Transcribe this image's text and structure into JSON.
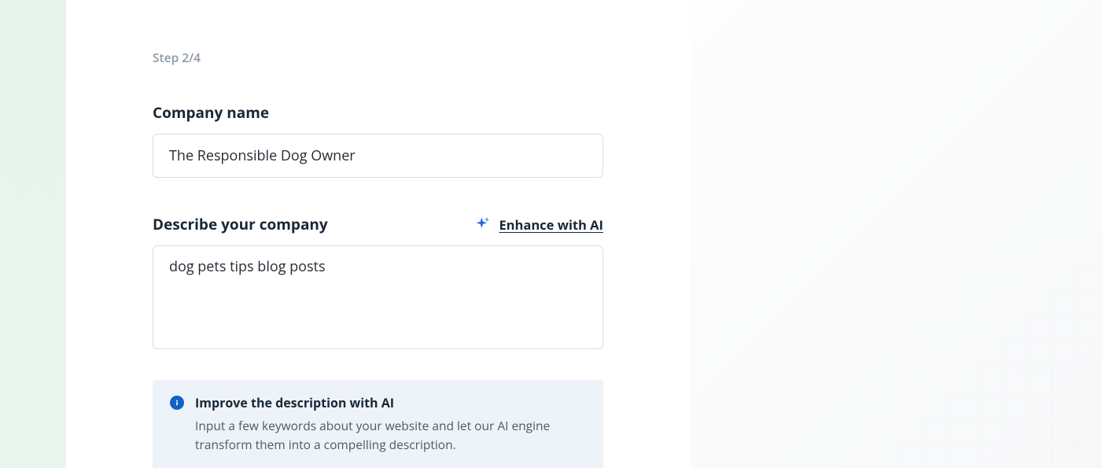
{
  "step": {
    "label": "Step 2/4"
  },
  "company": {
    "name_label": "Company name",
    "name_value": "The Responsible Dog Owner",
    "describe_label": "Describe your company",
    "describe_value": "dog pets tips blog posts"
  },
  "enhance": {
    "label": "Enhance with AI"
  },
  "info": {
    "title": "Improve the description with AI",
    "body": "Input a few keywords about your website and let our AI engine transform them into a compelling description."
  }
}
